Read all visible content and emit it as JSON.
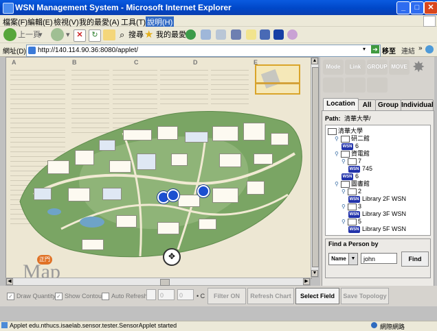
{
  "window": {
    "title": "WSN Management System - Microsoft Internet Explorer"
  },
  "menu": [
    "檔案(F)",
    "編輯(E)",
    "檢視(V)",
    "我的最愛(A)",
    "工具(T)",
    "說明(H)"
  ],
  "toolbar": {
    "back": "上一頁",
    "search": "搜尋",
    "favorites": "我的最愛"
  },
  "address": {
    "label": "網址(D)",
    "url": "http://140.114.90.36:8080/applet/",
    "go": "移至",
    "links": "連結"
  },
  "map": {
    "columns": [
      "A",
      "B",
      "C",
      "D",
      "E"
    ],
    "watermark": "Map",
    "gate_label": "正門"
  },
  "panel": {
    "mode_buttons": [
      "Mode",
      "Link",
      "GROUP",
      "MOVE"
    ],
    "tabs": [
      "Location",
      "All",
      "Group",
      "Individual"
    ],
    "active_tab": "Location",
    "path_label": "Path:",
    "path_value": "清華大學/",
    "tree": [
      {
        "depth": 0,
        "type": "folder",
        "label": "清華大學"
      },
      {
        "depth": 1,
        "type": "folder",
        "label": "研二館"
      },
      {
        "depth": 2,
        "type": "wsn",
        "label": "6"
      },
      {
        "depth": 1,
        "type": "folder",
        "label": "資電館"
      },
      {
        "depth": 2,
        "type": "folder",
        "label": "7"
      },
      {
        "depth": 3,
        "type": "wsn",
        "label": "745"
      },
      {
        "depth": 2,
        "type": "wsn",
        "label": "6"
      },
      {
        "depth": 1,
        "type": "folder",
        "label": "圖書館"
      },
      {
        "depth": 2,
        "type": "folder",
        "label": "2"
      },
      {
        "depth": 3,
        "type": "wsn",
        "label": "Library 2F WSN"
      },
      {
        "depth": 2,
        "type": "folder",
        "label": "3"
      },
      {
        "depth": 3,
        "type": "wsn",
        "label": "Library 3F WSN"
      },
      {
        "depth": 2,
        "type": "folder",
        "label": "5"
      },
      {
        "depth": 3,
        "type": "wsn",
        "label": "Library 5F WSN"
      }
    ],
    "find": {
      "title": "Find a Person by",
      "field": "Name",
      "value": "john",
      "button": "Find"
    }
  },
  "controls": {
    "draw_quantity": "Draw Quantity",
    "show_contour": "Show Contour",
    "auto_refresh": "Auto Refresh",
    "spin1": "0",
    "spin2": "0",
    "temp_unit": "C",
    "filter_on": "Filter ON",
    "refresh_chart": "Refresh Chart",
    "select_field": "Select Field",
    "save_topology": "Save Topology"
  },
  "status": {
    "text": "Applet edu.nthucs.isaelab.sensor.tester.SensorApplet started",
    "zone": "網際網路"
  },
  "colors": {
    "titlebar": "#0047c8",
    "marker": "#1b4fd0"
  }
}
